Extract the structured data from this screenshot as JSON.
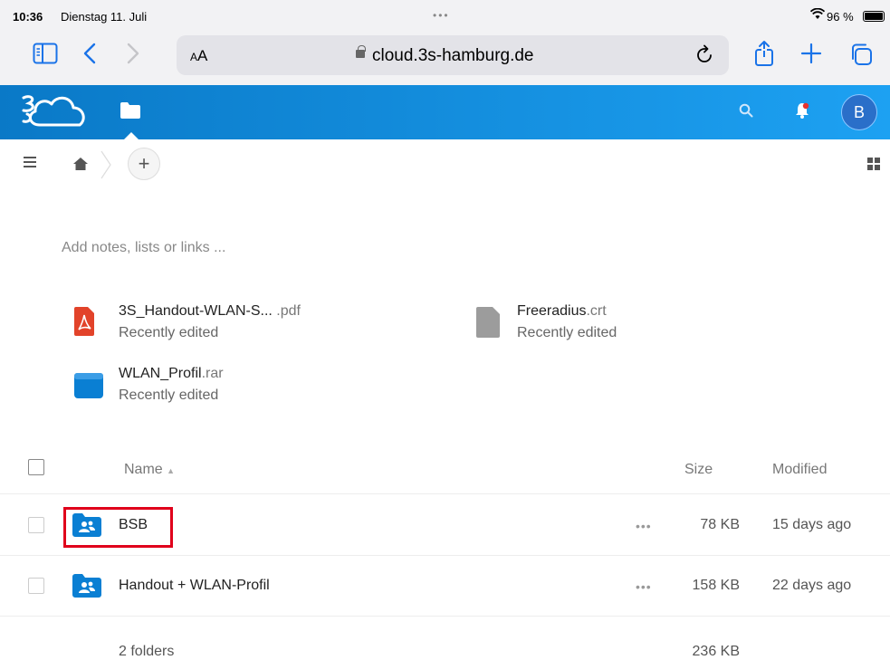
{
  "statusbar": {
    "time": "10:36",
    "date": "Dienstag 11. Juli",
    "battery": "96 %"
  },
  "browser": {
    "text_size_label": "AA",
    "url": "cloud.3s-hamburg.de",
    "icons": [
      "sidebar-icon",
      "back-icon",
      "forward-icon",
      "reload-icon",
      "share-icon",
      "new-tab-icon",
      "tabs-icon"
    ]
  },
  "header": {
    "avatar_initial": "B",
    "accent": "#0a79c7",
    "notification_dot": "#e9322d"
  },
  "breadcrumb": {
    "add_label": "+"
  },
  "notes_placeholder": "Add notes, lists or links ...",
  "recent": [
    {
      "name": "3S_Handout-WLAN-S...",
      "ext": " .pdf",
      "status": "Recently edited",
      "icon": "pdf-icon"
    },
    {
      "name": "Freeradius",
      "ext": ".crt",
      "status": "Recently edited",
      "icon": "file-icon"
    },
    {
      "name": "WLAN_Profil",
      "ext": ".rar",
      "status": "Recently edited",
      "icon": "archive-icon"
    }
  ],
  "table": {
    "columns": {
      "name": "Name",
      "size": "Size",
      "modified": "Modified"
    },
    "rows": [
      {
        "name": "BSB",
        "size": "78 KB",
        "modified": "15 days ago",
        "actions": "•••"
      },
      {
        "name": "Handout + WLAN-Profil",
        "size": "158 KB",
        "modified": "22 days ago",
        "actions": "•••"
      }
    ],
    "summary": {
      "count": "2 folders",
      "total": "236 KB"
    }
  }
}
